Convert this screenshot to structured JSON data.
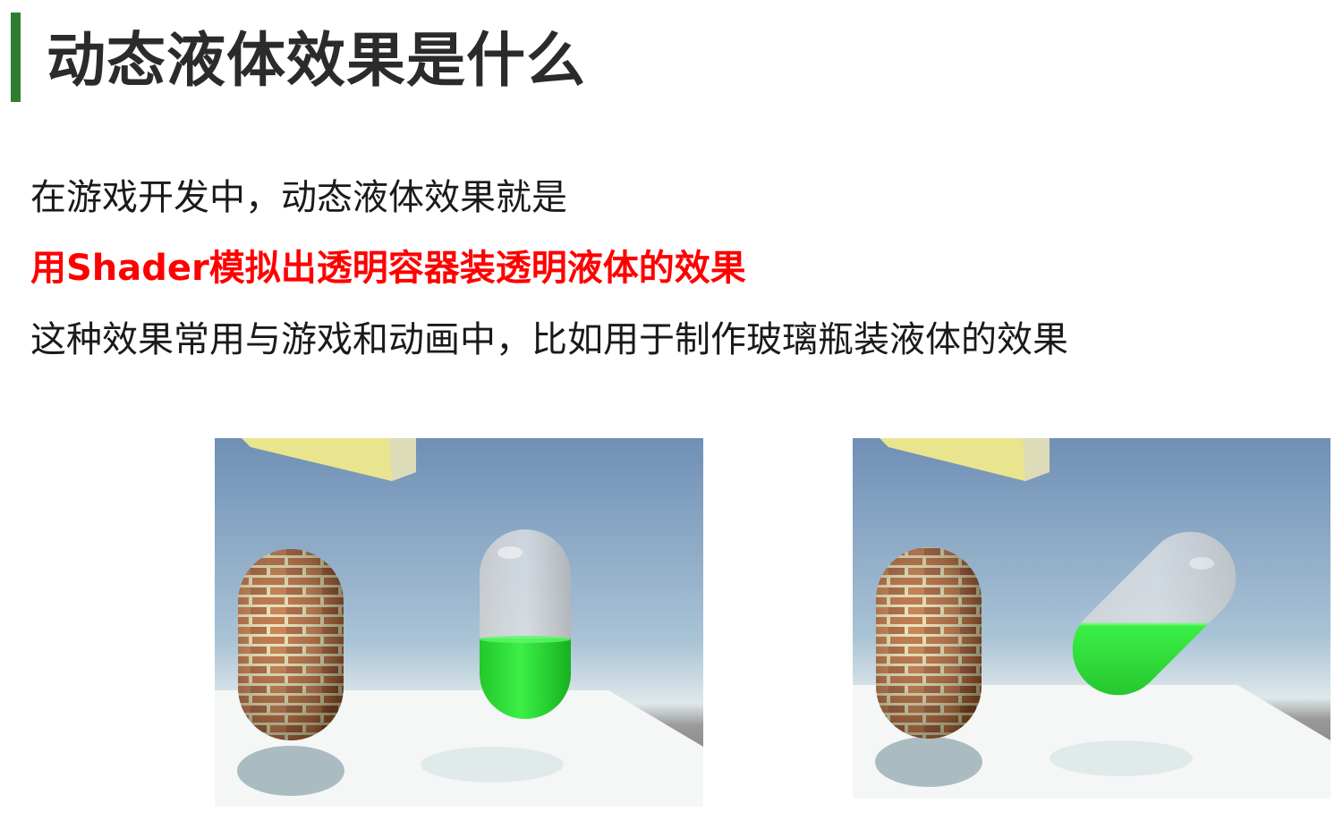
{
  "slide": {
    "title": "动态液体效果是什么",
    "lines": [
      "在游戏开发中，动态液体效果就是",
      "用Shader模拟出透明容器装透明液体的效果",
      "这种效果常用与游戏和动画中，比如用于制作玻璃瓶装液体的效果"
    ],
    "accent_color": "#2e7d32",
    "highlight_color": "#ff0000",
    "liquid_color": "#1ed62a"
  },
  "images": [
    {
      "name": "upright capsule scene",
      "state": "upright"
    },
    {
      "name": "tilted capsule scene",
      "state": "tilted"
    }
  ]
}
